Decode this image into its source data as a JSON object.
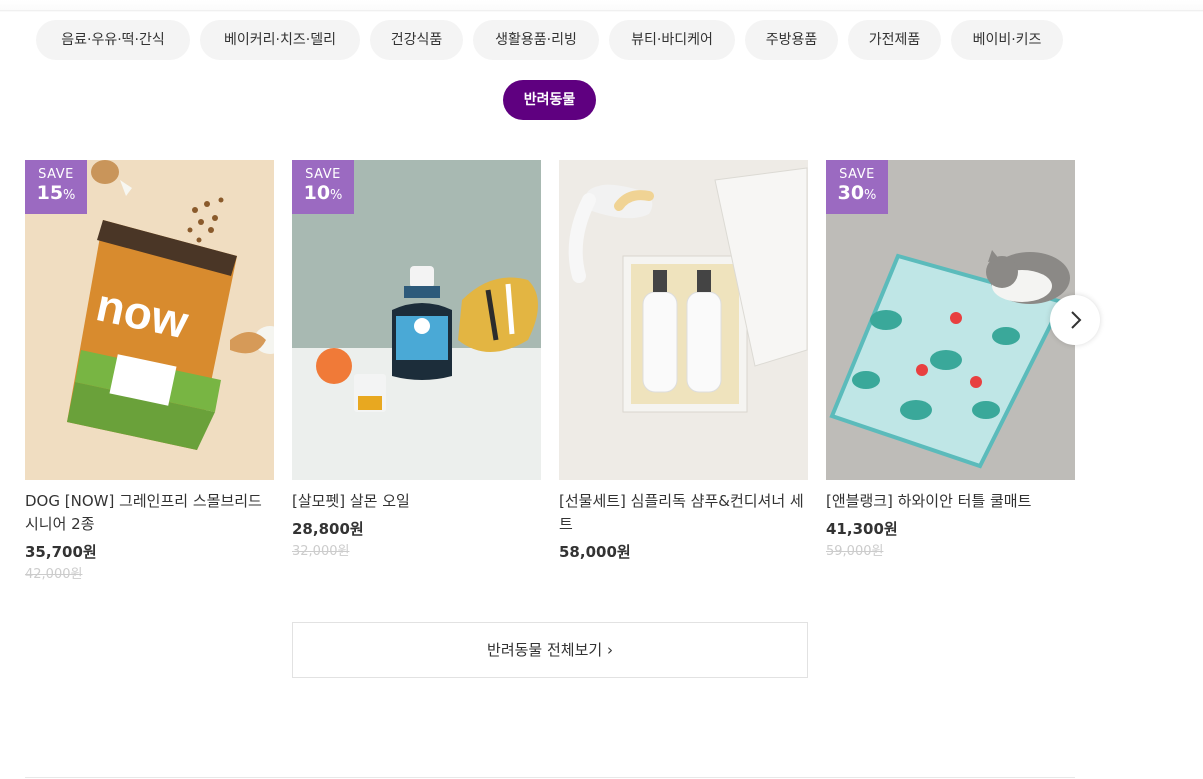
{
  "categories": [
    {
      "label": "음료·우유·떡·간식",
      "active": false
    },
    {
      "label": "베이커리·치즈·델리",
      "active": false
    },
    {
      "label": "건강식품",
      "active": false
    },
    {
      "label": "생활용품·리빙",
      "active": false
    },
    {
      "label": "뷰티·바디케어",
      "active": false
    },
    {
      "label": "주방용품",
      "active": false
    },
    {
      "label": "가전제품",
      "active": false
    },
    {
      "label": "베이비·키즈",
      "active": false
    },
    {
      "label": "반려동물",
      "active": true
    }
  ],
  "products": [
    {
      "save_label": "SAVE",
      "discount": "15",
      "percent_sign": "%",
      "name": "DOG [NOW] 그레인프리 스몰브리드 시니어 2종",
      "price": "35,700원",
      "original_price": "42,000원"
    },
    {
      "save_label": "SAVE",
      "discount": "10",
      "percent_sign": "%",
      "name": "[살모펫] 살몬 오일",
      "price": "28,800원",
      "original_price": "32,000원"
    },
    {
      "save_label": "",
      "discount": "",
      "percent_sign": "",
      "name": "[선물세트] 심플리독 샴푸&컨디셔너 세트",
      "price": "58,000원",
      "original_price": ""
    },
    {
      "save_label": "SAVE",
      "discount": "30",
      "percent_sign": "%",
      "name": "[앤블랭크] 하와이안 터틀 쿨매트",
      "price": "41,300원",
      "original_price": "59,000원"
    }
  ],
  "view_all": {
    "label": "반려동물 전체보기",
    "arrow": "›"
  },
  "carousel": {
    "next_icon": "chevron-right-icon"
  },
  "colors": {
    "accent": "#5f0080",
    "badge": "#9b6ac1",
    "chip_bg": "#f4f4f4"
  }
}
